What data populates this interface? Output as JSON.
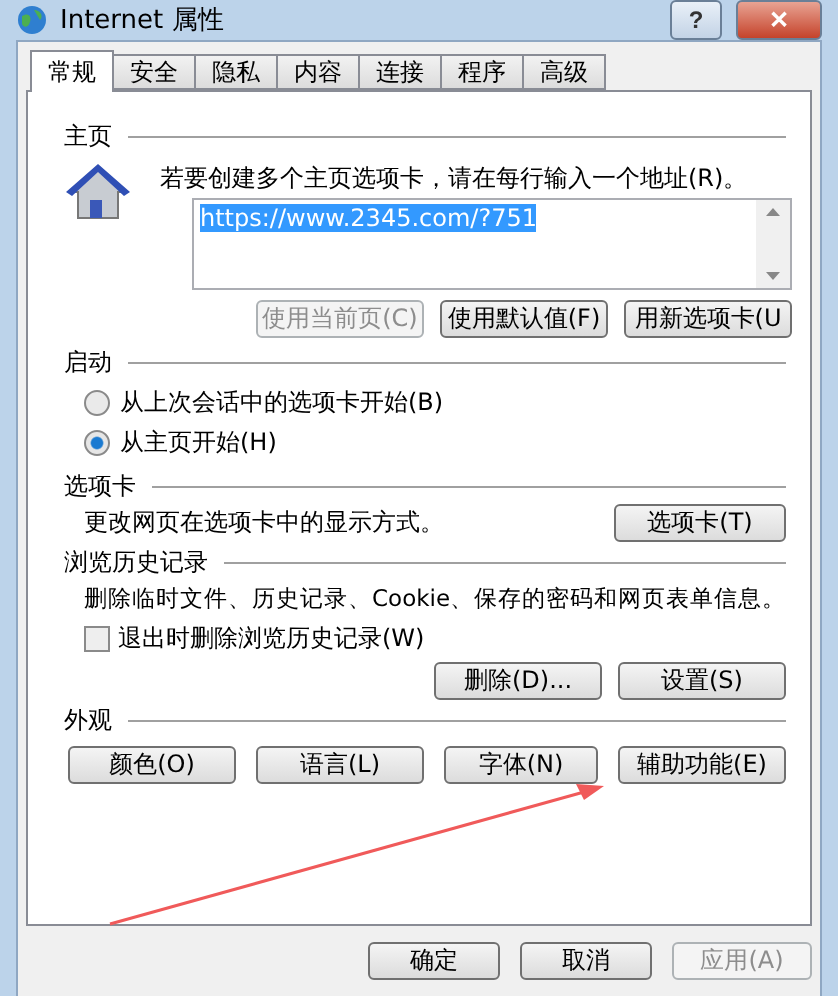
{
  "window": {
    "title": "Internet 属性"
  },
  "title_buttons": [
    {
      "kind": "help",
      "label": "?"
    },
    {
      "kind": "close",
      "label": "✕"
    }
  ],
  "tabs": [
    {
      "label": "常规",
      "selected": true
    },
    {
      "label": "安全",
      "selected": false
    },
    {
      "label": "隐私",
      "selected": false
    },
    {
      "label": "内容",
      "selected": false
    },
    {
      "label": "连接",
      "selected": false
    },
    {
      "label": "程序",
      "selected": false
    },
    {
      "label": "高级",
      "selected": false
    }
  ],
  "home_page": {
    "heading": "主页",
    "instruction": "若要创建多个主页选项卡，请在每行输入一个地址(R)。",
    "address": "https://www.2345.com/?751",
    "buttons": [
      {
        "label": "使用当前页(C)",
        "disabled": true
      },
      {
        "label": "使用默认值(F)",
        "disabled": false
      },
      {
        "label": "用新选项卡(U",
        "disabled": false
      }
    ]
  },
  "startup": {
    "heading": "启动",
    "options": [
      {
        "label": "从上次会话中的选项卡开始(B)",
        "selected": false
      },
      {
        "label": "从主页开始(H)",
        "selected": true
      }
    ]
  },
  "tabs_section": {
    "heading": "选项卡",
    "description": "更改网页在选项卡中的显示方式。",
    "button": "选项卡(T)"
  },
  "history": {
    "heading": "浏览历史记录",
    "description": "删除临时文件、历史记录、Cookie、保存的密码和网页表单信息。",
    "checkbox": {
      "label": "退出时删除浏览历史记录(W)",
      "checked": false
    },
    "buttons": [
      "删除(D)...",
      "设置(S)"
    ]
  },
  "appearance": {
    "heading": "外观",
    "buttons": [
      "颜色(O)",
      "语言(L)",
      "字体(N)",
      "辅助功能(E)"
    ]
  },
  "footer_buttons": [
    {
      "label": "确定",
      "disabled": false
    },
    {
      "label": "取消",
      "disabled": false
    },
    {
      "label": "应用(A)",
      "disabled": true
    }
  ]
}
